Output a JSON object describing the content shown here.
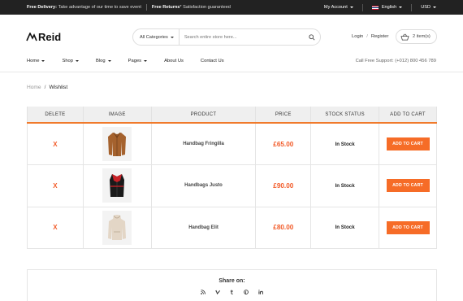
{
  "topbar": {
    "delivery_label": "Free Delivery:",
    "delivery_text": "Take advantage of our time to save event",
    "returns_label": "Free Returns",
    "returns_text": "* Satisfaction guaranteed",
    "account": "My Account",
    "language": "English",
    "currency": "USD"
  },
  "header": {
    "logo_text": "Reid",
    "search_category": "All Categories",
    "search_placeholder": "Search entire store here...",
    "login": "Login",
    "register": "Register",
    "cart_label": "2 item(s)"
  },
  "nav": {
    "items": [
      "Home",
      "Shop",
      "Blog",
      "Pages",
      "About Us",
      "Contact Us"
    ],
    "support": "Call Free Support: (+012) 800 456 789"
  },
  "breadcrumb": {
    "home": "Home",
    "current": "Wishlist"
  },
  "wishlist": {
    "headers": [
      "DELETE",
      "IMAGE",
      "PRODUCT",
      "PRICE",
      "STOCK STATUS",
      "ADD TO CART"
    ],
    "rows": [
      {
        "delete": "X",
        "image": "brown-jacket",
        "product": "Handbag Fringilla",
        "price": "£65.00",
        "stock": "In Stock",
        "button": "ADD TO CART"
      },
      {
        "delete": "X",
        "image": "black-red-vest",
        "product": "Handbags Justo",
        "price": "£90.00",
        "stock": "In Stock",
        "button": "ADD TO CART"
      },
      {
        "delete": "X",
        "image": "beige-hoodie",
        "product": "Handbag Elit",
        "price": "£80.00",
        "stock": "In Stock",
        "button": "ADD TO CART"
      }
    ]
  },
  "share": {
    "title": "Share on:",
    "icons": [
      "rss-icon",
      "vimeo-icon",
      "tumblr-icon",
      "pinterest-icon",
      "linkedin-icon"
    ]
  },
  "colors": {
    "accent": "#f66c27",
    "price": "#f25c2a",
    "topbar": "#222222"
  }
}
